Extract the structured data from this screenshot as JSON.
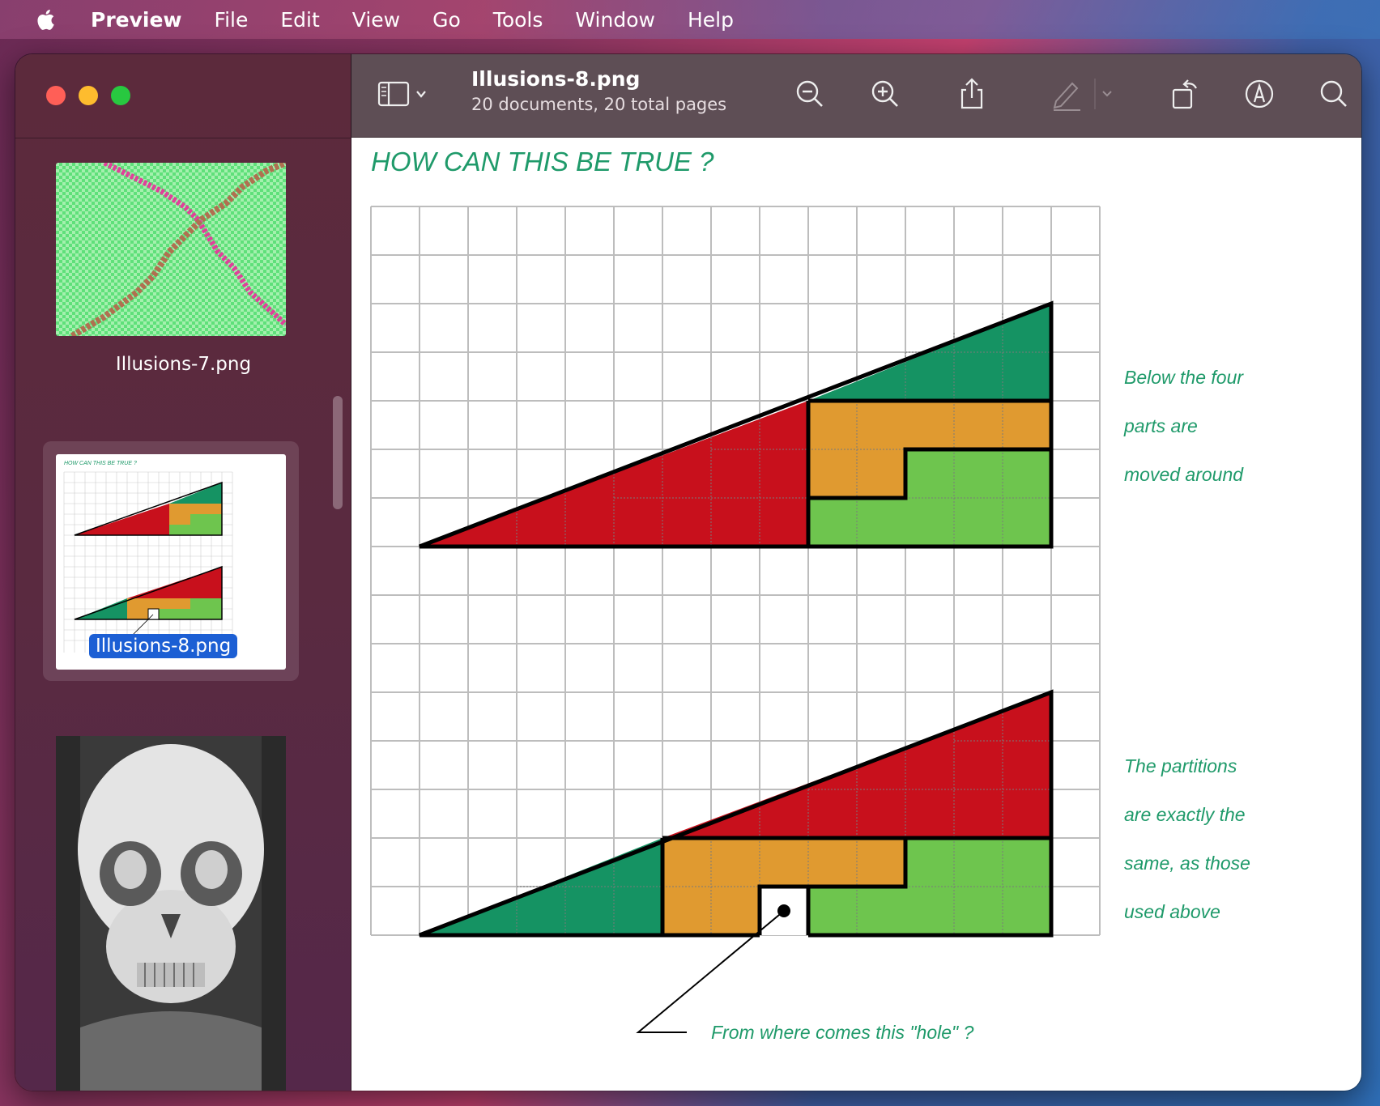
{
  "menubar": {
    "app_name": "Preview",
    "items": [
      "File",
      "Edit",
      "View",
      "Go",
      "Tools",
      "Window",
      "Help"
    ]
  },
  "window": {
    "title": "Illusions-8.png",
    "subtitle": "20 documents, 20 total pages"
  },
  "toolbar": {
    "icons": [
      "sidebar-toggle-icon",
      "zoom-out-icon",
      "zoom-in-icon",
      "share-icon",
      "highlight-pen-icon",
      "rotate-icon",
      "markup-icon",
      "search-icon"
    ]
  },
  "sidebar": {
    "items": [
      {
        "label": "Illusions-7.png",
        "selected": false
      },
      {
        "label": "Illusions-8.png",
        "selected": true
      }
    ]
  },
  "document": {
    "heading": "HOW CAN THIS BE TRUE ?",
    "note_top": [
      "Below the four",
      "parts are",
      "moved around"
    ],
    "note_bottom": [
      "The partitions",
      "are exactly the",
      "same, as those",
      "used above"
    ],
    "hole_caption": "From where comes this \"hole\" ?",
    "colors": {
      "text_green": "#1f9a6a",
      "red": "#c8101c",
      "orange": "#e09a30",
      "light_green": "#6ec54e",
      "dark_green": "#159363"
    }
  }
}
